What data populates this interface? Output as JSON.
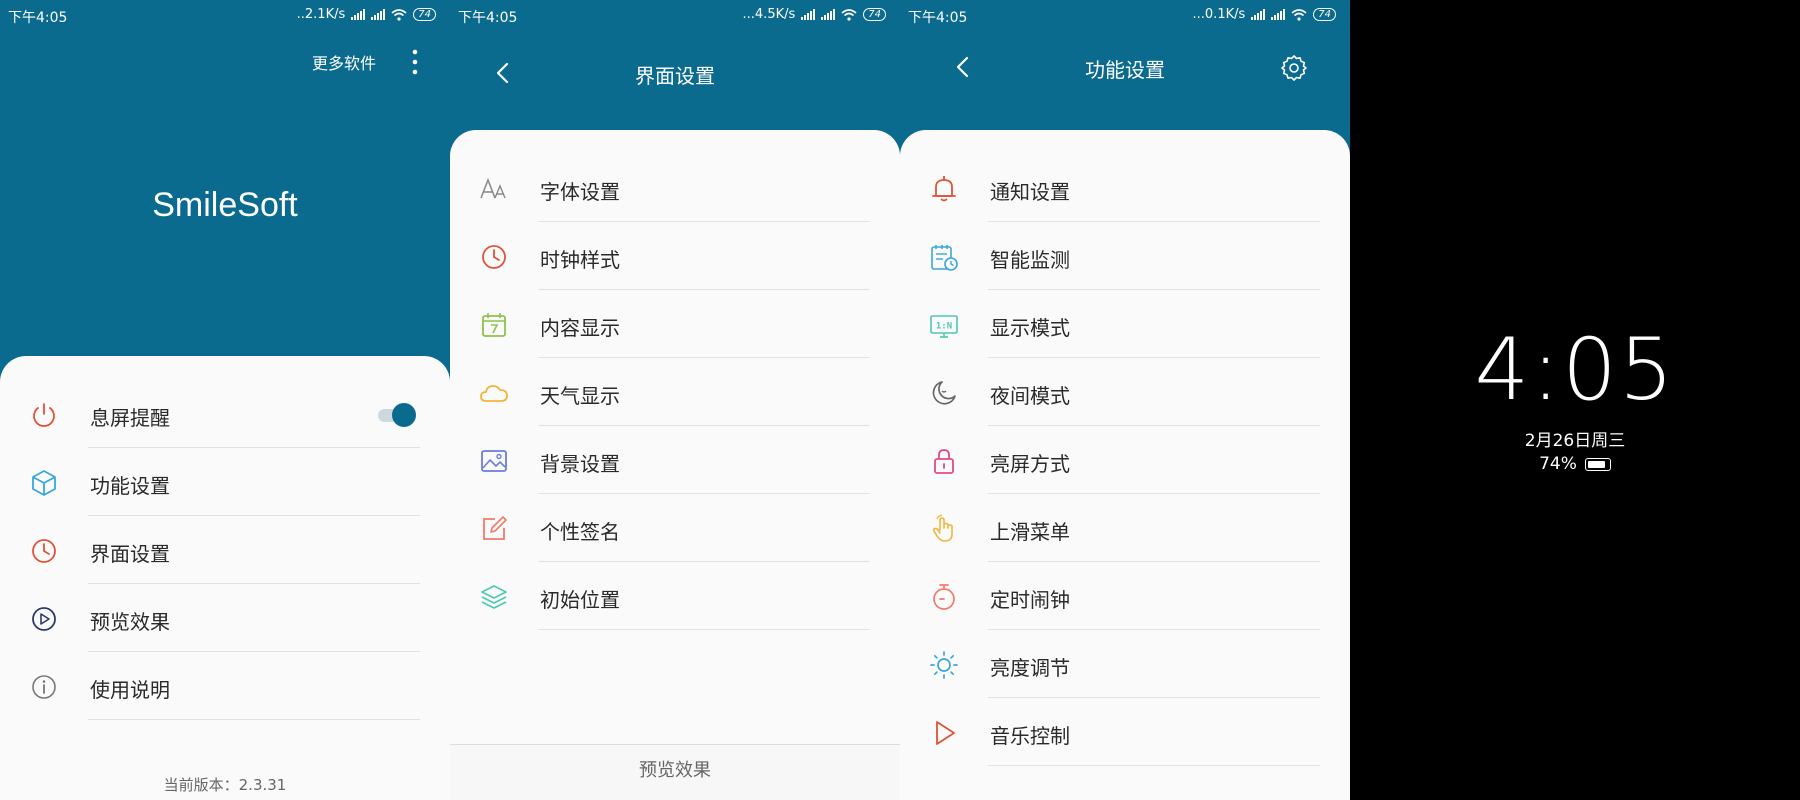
{
  "screen1": {
    "status": {
      "time": "下午4:05",
      "speed": "..2.1K/s",
      "battery": "74"
    },
    "more_software": "更多软件",
    "app_name": "SmileSoft",
    "items": [
      {
        "label": "息屏提醒",
        "icon": "power-icon",
        "color": "#e0533a"
      },
      {
        "label": "功能设置",
        "icon": "cube-icon",
        "color": "#3aa7d8"
      },
      {
        "label": "界面设置",
        "icon": "clock-icon",
        "color": "#e0533a"
      },
      {
        "label": "预览效果",
        "icon": "play-circle-icon",
        "color": "#2b3a6b"
      },
      {
        "label": "使用说明",
        "icon": "info-icon",
        "color": "#777777"
      }
    ],
    "toggle_on": true,
    "version": "当前版本：2.3.31"
  },
  "screen2": {
    "status": {
      "time": "下午4:05",
      "speed": "...4.5K/s",
      "battery": "74"
    },
    "title": "界面设置",
    "items": [
      {
        "label": "字体设置",
        "icon": "font-icon",
        "color": "#888888"
      },
      {
        "label": "时钟样式",
        "icon": "clock-icon",
        "color": "#e0533a"
      },
      {
        "label": "内容显示",
        "icon": "calendar-icon",
        "color": "#8bc34a"
      },
      {
        "label": "天气显示",
        "icon": "cloud-icon",
        "color": "#f2b53a"
      },
      {
        "label": "背景设置",
        "icon": "image-icon",
        "color": "#6a7fd6"
      },
      {
        "label": "个性签名",
        "icon": "edit-icon",
        "color": "#f07a6b"
      },
      {
        "label": "初始位置",
        "icon": "layers-icon",
        "color": "#4cc9b0"
      }
    ],
    "preview": "预览效果"
  },
  "screen3": {
    "status": {
      "time": "下午4:05",
      "speed": "...0.1K/s",
      "battery": "74"
    },
    "title": "功能设置",
    "items": [
      {
        "label": "通知设置",
        "icon": "bell-icon",
        "color": "#e0533a"
      },
      {
        "label": "智能监测",
        "icon": "schedule-icon",
        "color": "#3aa7d8"
      },
      {
        "label": "显示模式",
        "icon": "display-mode-icon",
        "color": "#4cc9b0"
      },
      {
        "label": "夜间模式",
        "icon": "moon-icon",
        "color": "#666666"
      },
      {
        "label": "亮屏方式",
        "icon": "lock-icon",
        "color": "#e04a8a"
      },
      {
        "label": "上滑菜单",
        "icon": "hand-icon",
        "color": "#f2b53a"
      },
      {
        "label": "定时闹钟",
        "icon": "timer-icon",
        "color": "#f07a6b"
      },
      {
        "label": "亮度调节",
        "icon": "sun-icon",
        "color": "#3aa7d8"
      },
      {
        "label": "音乐控制",
        "icon": "play-icon",
        "color": "#e0533a"
      }
    ],
    "display_mode_text": "1:N"
  },
  "screen4": {
    "clock": "4:05",
    "date": "2月26日周三",
    "battery": "74%"
  },
  "colors": {
    "accent": "#0b6b8f",
    "card": "#fafafa",
    "lock_bg": "#000000"
  }
}
